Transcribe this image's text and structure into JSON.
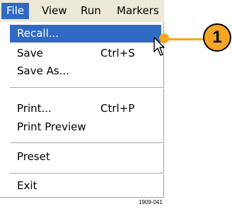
{
  "menubar": {
    "items": [
      {
        "label": "File",
        "active": true
      },
      {
        "label": "View",
        "active": false
      },
      {
        "label": "Run",
        "active": false
      },
      {
        "label": "Markers",
        "active": false
      }
    ]
  },
  "file_menu": {
    "items": [
      {
        "label": "Recall...",
        "shortcut": "",
        "highlighted": true
      },
      {
        "label": "Save",
        "shortcut": "Ctrl+S"
      },
      {
        "label": "Save As...",
        "shortcut": ""
      },
      {
        "label": "Print...",
        "shortcut": "Ctrl+P"
      },
      {
        "label": "Print Preview",
        "shortcut": ""
      },
      {
        "label": "Preset",
        "shortcut": ""
      },
      {
        "label": "Exit",
        "shortcut": ""
      }
    ]
  },
  "callout": {
    "number": "1",
    "color": "#f5a623"
  },
  "cursor_icon": "arrow-pointer",
  "figure_id": "1909-041",
  "colors": {
    "highlight": "#316ac5",
    "menubar_bg": "#ece9d8"
  }
}
